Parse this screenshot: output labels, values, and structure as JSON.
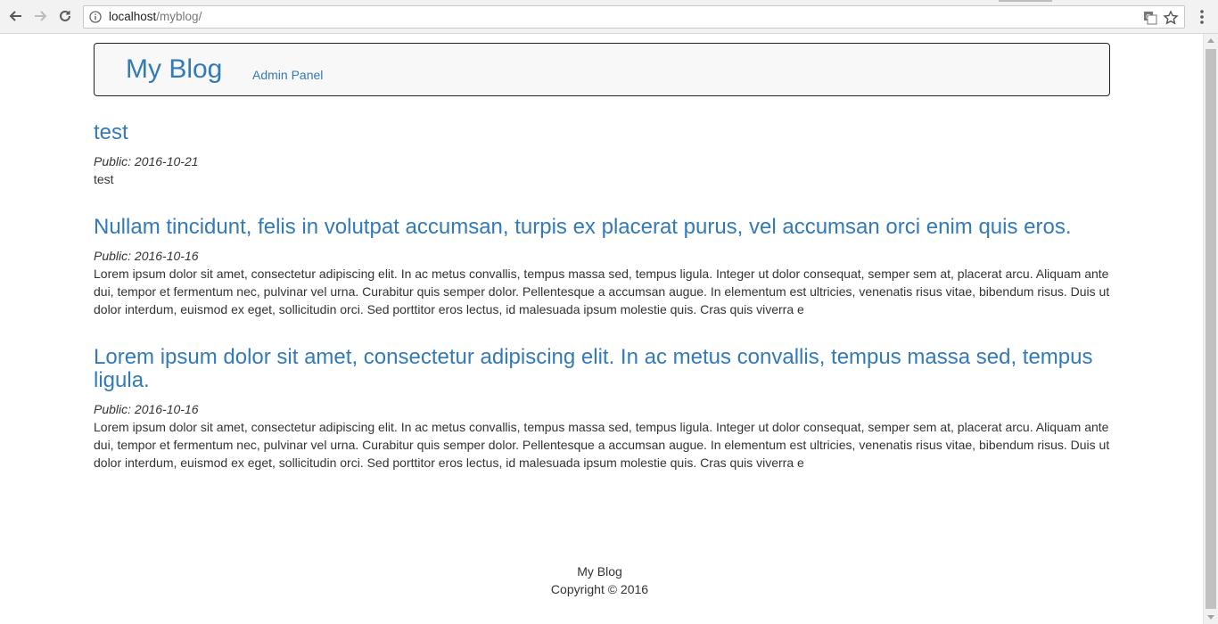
{
  "browser": {
    "url_host": "localhost",
    "url_path": "/myblog/"
  },
  "header": {
    "brand": "My Blog",
    "admin_link": "Admin Panel"
  },
  "posts": [
    {
      "title": "test",
      "date": "Public: 2016-10-21",
      "body": "test"
    },
    {
      "title": "Nullam tincidunt, felis in volutpat accumsan, turpis ex placerat purus, vel accumsan orci enim quis eros.",
      "date": "Public: 2016-10-16",
      "body": "Lorem ipsum dolor sit amet, consectetur adipiscing elit. In ac metus convallis, tempus massa sed, tempus ligula. Integer ut dolor consequat, semper sem at, placerat arcu. Aliquam ante dui, tempor et fermentum nec, pulvinar vel urna. Curabitur quis semper dolor. Pellentesque a accumsan augue. In elementum est ultricies, venenatis risus vitae, bibendum risus. Duis ut dolor interdum, euismod ex eget, sollicitudin orci. Sed porttitor eros lectus, id malesuada ipsum molestie quis. Cras quis viverra e"
    },
    {
      "title": "Lorem ipsum dolor sit amet, consectetur adipiscing elit. In ac metus convallis, tempus massa sed, tempus ligula.",
      "date": "Public: 2016-10-16",
      "body": "Lorem ipsum dolor sit amet, consectetur adipiscing elit. In ac metus convallis, tempus massa sed, tempus ligula. Integer ut dolor consequat, semper sem at, placerat arcu. Aliquam ante dui, tempor et fermentum nec, pulvinar vel urna. Curabitur quis semper dolor. Pellentesque a accumsan augue. In elementum est ultricies, venenatis risus vitae, bibendum risus. Duis ut dolor interdum, euismod ex eget, sollicitudin orci. Sed porttitor eros lectus, id malesuada ipsum molestie quis. Cras quis viverra e"
    }
  ],
  "footer": {
    "line1": "My Blog",
    "line2": "Copyright © 2016"
  },
  "colors": {
    "link": "#337ab7",
    "text": "#333333",
    "header_bg": "#f8f8f8"
  }
}
